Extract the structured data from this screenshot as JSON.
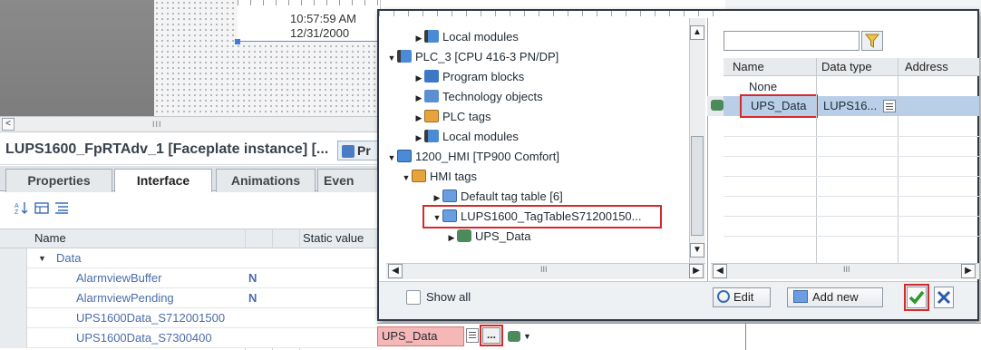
{
  "canvas": {
    "clock_time": "10:57:59 AM",
    "clock_date": "12/31/2000",
    "scroll_grip": "III",
    "scroll_left": "<"
  },
  "faceplate": {
    "title": "LUPS1600_FpRTAdv_1 [Faceplate instance] [...",
    "pr_label": "Pr"
  },
  "tabs": [
    "Properties",
    "Interface",
    "Animations",
    "Even"
  ],
  "active_tab": "Interface",
  "interface_table": {
    "col_name": "Name",
    "col_static": "Static value",
    "rows": [
      {
        "label": "Data",
        "expanded": true,
        "indent": 0
      },
      {
        "label": "AlarmviewBuffer",
        "indent": 1,
        "icon": "N"
      },
      {
        "label": "AlarmviewPending",
        "indent": 1,
        "icon": "N"
      },
      {
        "label": "UPS1600Data_S712001500",
        "indent": 1
      },
      {
        "label": "UPS1600Data_S7300400",
        "indent": 1
      }
    ]
  },
  "tree": {
    "items": [
      {
        "label": "Local modules",
        "icon": "module-icon",
        "indent": 1,
        "arrow": "right"
      },
      {
        "label": "PLC_3 [CPU 416-3 PN/DP]",
        "icon": "plc-icon",
        "indent": 0,
        "arrow": "down"
      },
      {
        "label": "Program blocks",
        "icon": "program-blocks-icon",
        "indent": 1,
        "arrow": "right"
      },
      {
        "label": "Technology objects",
        "icon": "technology-icon",
        "indent": 1,
        "arrow": "right"
      },
      {
        "label": "PLC tags",
        "icon": "plc-tags-icon",
        "indent": 1,
        "arrow": "right"
      },
      {
        "label": "Local modules",
        "icon": "module-icon",
        "indent": 1,
        "arrow": "right"
      },
      {
        "label": "1200_HMI [TP900 Comfort]",
        "icon": "hmi-device-icon",
        "indent": 0,
        "arrow": "down"
      },
      {
        "label": "HMI tags",
        "icon": "hmi-tags-icon",
        "indent": 1,
        "arrow": "down"
      },
      {
        "label": "Default tag table [6]",
        "icon": "tag-table-icon",
        "indent": 2,
        "arrow": "right"
      },
      {
        "label": "LUPS1600_TagTableS71200150...",
        "icon": "tag-table-icon",
        "indent": 2,
        "arrow": "down",
        "highlight": true
      },
      {
        "label": "UPS_Data",
        "icon": "variable-icon",
        "indent": 3,
        "arrow": "right"
      }
    ],
    "scroll_grip": "III"
  },
  "list": {
    "headers": [
      "Name",
      "Data type",
      "Address"
    ],
    "none_label": "None",
    "selected_row": {
      "name": "UPS_Data",
      "type": "LUPS16...",
      "address": ""
    },
    "scroll_grip": "III"
  },
  "footer": {
    "show_all": "Show all",
    "edit": "Edit",
    "add_new": "Add new"
  },
  "bottom": {
    "field_value": "UPS_Data",
    "browse_label": "..."
  },
  "colors": {
    "accent": "#4a6da8",
    "highlight_red": "#d42a2a",
    "selection_blue": "#b9cfe8",
    "field_error": "#f6b7b7",
    "ok_green": "#2a9a2a",
    "cancel_blue": "#2a5bb0"
  }
}
